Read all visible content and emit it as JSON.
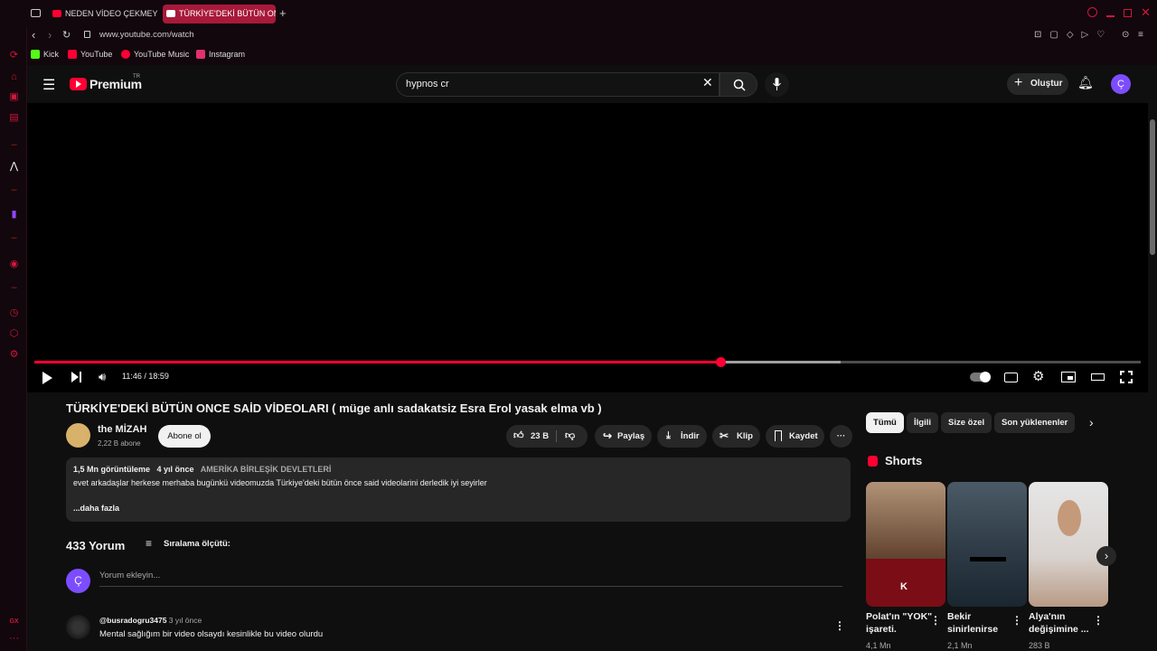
{
  "browser": {
    "tabs": [
      {
        "label": "NEDEN VİDEO ÇEKMEYİ BIRAKTIM",
        "active": false
      },
      {
        "label": "TÜRKİYE'DEKİ BÜTÜN ONCE SAİD VİDEOLARI",
        "active": true
      }
    ],
    "url": "www.youtube.com/watch",
    "bookmarks": [
      {
        "label": "Kick",
        "color": "#53fc18"
      },
      {
        "label": "YouTube",
        "color": "#ff0033"
      },
      {
        "label": "YouTube Music",
        "color": "#ff0033"
      },
      {
        "label": "Instagram",
        "color": "#e1306c"
      }
    ],
    "sidebar_footer": "GX"
  },
  "youtube": {
    "logo_text": "Premium",
    "logo_region": "TR",
    "search_value": "hypnos cr",
    "create_label": "Oluştur",
    "avatar_letter": "Ç",
    "accent": "#ff0033"
  },
  "player": {
    "time": "11:46 / 18:59",
    "progress_fraction": 0.62,
    "buffered_fraction": 0.729
  },
  "video": {
    "title": "TÜRKİYE'DEKİ BÜTÜN ONCE SAİD VİDEOLARI ( müge anlı sadakatsiz Esra Erol yasak elma vb )",
    "channel_name": "the MİZAH",
    "subscribers": "2,22 B abone",
    "subscribe_label": "Abone ol",
    "likes": "23 B",
    "share_label": "Paylaş",
    "download_label": "İndir",
    "clip_label": "Klip",
    "save_label": "Kaydet",
    "more_label": "···"
  },
  "description": {
    "views": "1,5 Mn görüntüleme",
    "age": "4 yıl önce",
    "location": "AMERİKA BİRLEŞİK DEVLETLERİ",
    "text": "evet arkadaşlar herkese merhaba bugünkü videomuzda Türkiye'deki bütün önce said videolarini derledik iyi seyirler",
    "more": "...daha fazla"
  },
  "comments": {
    "count": "433 Yorum",
    "sort_label": "Sıralama ölçütü:",
    "input_placeholder": "Yorum ekleyin...",
    "items": [
      {
        "author": "@busradogru3475",
        "age": "3 yıl önce",
        "text": "Mental sağlığım bir video olsaydı kesinlikle bu video olurdu"
      }
    ]
  },
  "related": {
    "chips": [
      "Tümü",
      "İlgili",
      "Size özel",
      "Son yüklenenler"
    ],
    "shorts_heading": "Shorts",
    "shorts": [
      {
        "title": "Polat'ın \"YOK\" işareti.",
        "views": "4,1 Mn"
      },
      {
        "title": "Bekir sinirlenirse",
        "views": "2,1 Mn"
      },
      {
        "title": "Alya'nın değişimine ...",
        "views": "283 B"
      }
    ]
  }
}
